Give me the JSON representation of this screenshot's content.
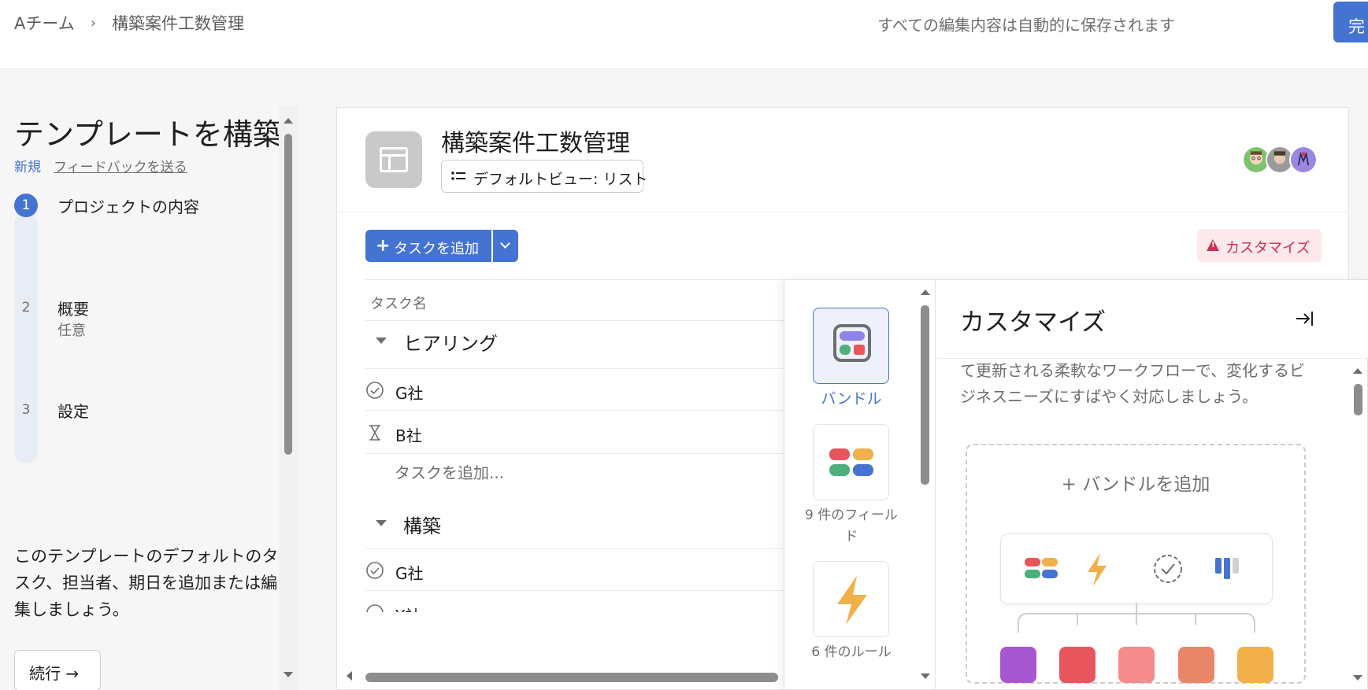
{
  "header": {
    "breadcrumb_team": "Aチーム",
    "breadcrumb_sep": "›",
    "breadcrumb_project": "構築案件工数管理",
    "autosave_text": "すべての編集内容は自動的に保存されます",
    "done_label": "完"
  },
  "wizard": {
    "title": "テンプレートを構築",
    "new_label": "新規",
    "feedback_link": "フィードバックを送る",
    "steps": [
      {
        "num": "1",
        "label": "プロジェクトの内容",
        "sub": ""
      },
      {
        "num": "2",
        "label": "概要",
        "sub": "任意"
      },
      {
        "num": "3",
        "label": "設定",
        "sub": ""
      }
    ],
    "description": "このテンプレートのデフォルトのタスク、担当者、期日を追加または編集しましょう。",
    "continue_label": "続行 →"
  },
  "project": {
    "title": "構築案件工数管理",
    "default_view": "デフォルトビュー: リスト",
    "add_task_label": "タスクを追加",
    "customize_badge": "カスタマイズ",
    "column_task_name": "タスク名",
    "sections": [
      {
        "name": "ヒアリング",
        "tasks": [
          {
            "name": "G社",
            "status": "complete"
          },
          {
            "name": "B社",
            "status": "waiting"
          }
        ],
        "add_task": "タスクを追加..."
      },
      {
        "name": "構築",
        "tasks": [
          {
            "name": "G社",
            "status": "complete"
          },
          {
            "name": "Y社",
            "status": "complete"
          }
        ]
      }
    ]
  },
  "customize_panel": {
    "title": "カスタマイズ",
    "body_text": "て更新される柔軟なワークフローで、変化するビジネスニーズにすばやく対応しましょう。",
    "add_bundle": "+ バンドルを追加",
    "rail": [
      {
        "label": "バンドル",
        "icon": "bundle-icon",
        "active": true
      },
      {
        "label": "9 件のフィールド",
        "icon": "fields-icon",
        "active": false
      },
      {
        "label": "6 件のルール",
        "icon": "rule-lightning-icon",
        "active": false
      }
    ]
  },
  "colors": {
    "accent": "#4573d2",
    "customize_text": "#c92f54",
    "customize_bg": "#fde9eb"
  }
}
